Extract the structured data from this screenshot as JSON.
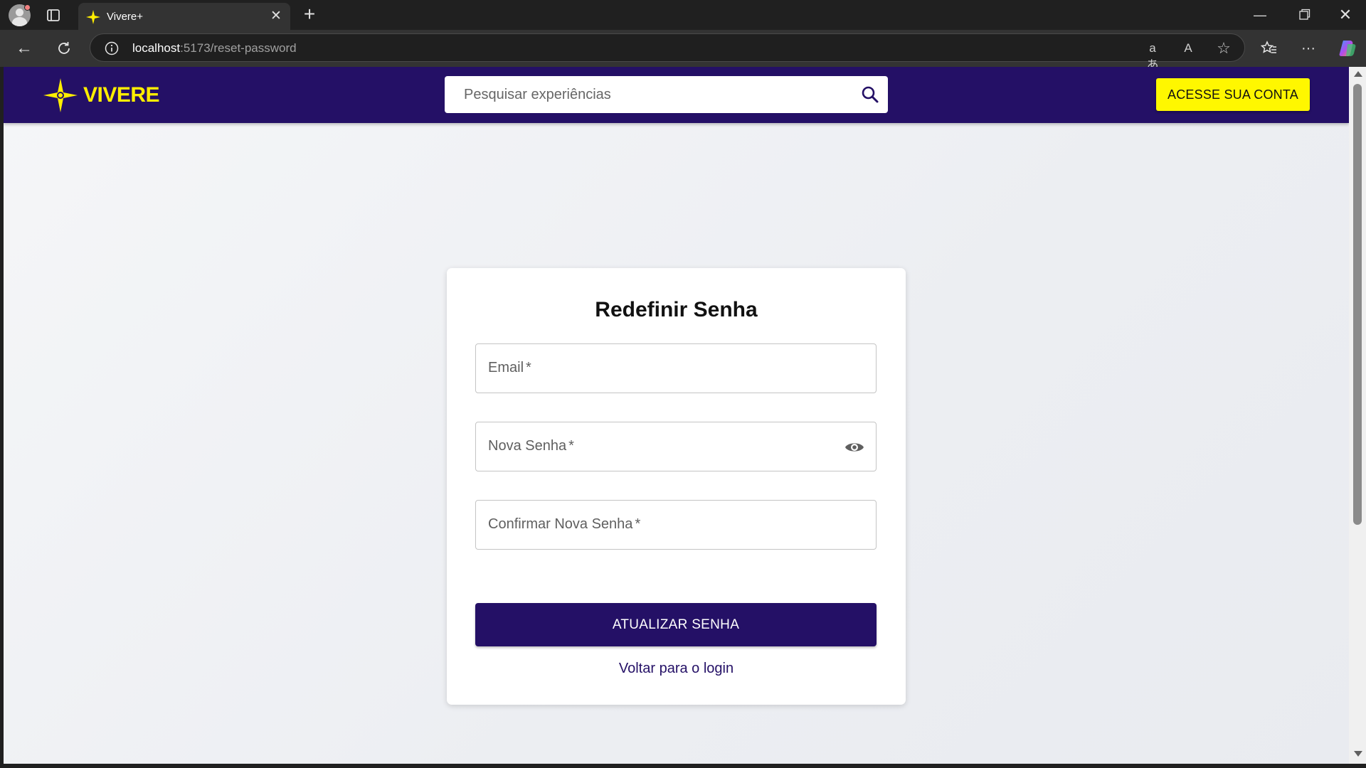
{
  "browser": {
    "tab_title": "Vivere+",
    "url_host": "localhost",
    "url_path": ":5173/reset-password",
    "min_glyph": "—",
    "close_glyph": "✕",
    "new_tab_glyph": "+",
    "tab_close_glyph": "✕",
    "back_glyph": "←",
    "more_glyph": "···",
    "translate_glyph": "aあ",
    "read_aloud_glyph": "A",
    "favorite_glyph": "☆",
    "icons": [
      "profile-icon",
      "tab-actions-icon",
      "new-tab-icon",
      "back-icon",
      "refresh-icon",
      "site-info-icon",
      "translate-icon",
      "read-aloud-icon",
      "favorite-star-icon",
      "favorites-icon",
      "more-icon",
      "copilot-icon"
    ]
  },
  "header": {
    "logo_text": "VIVERE",
    "search_placeholder": "Pesquisar experiências",
    "login_button": "ACESSE SUA CONTA"
  },
  "card": {
    "title": "Redefinir Senha",
    "fields": [
      {
        "label": "Email",
        "required_mark": "*"
      },
      {
        "label": "Nova Senha",
        "required_mark": "*"
      },
      {
        "label": "Confirmar Nova Senha",
        "required_mark": "*"
      }
    ],
    "submit_label": "ATUALIZAR SENHA",
    "back_link": "Voltar para o login"
  },
  "colors": {
    "brand_primary": "#241066",
    "brand_accent": "#fff700",
    "logo_yellow": "#ffee00",
    "page_background": "#eef0f4"
  }
}
